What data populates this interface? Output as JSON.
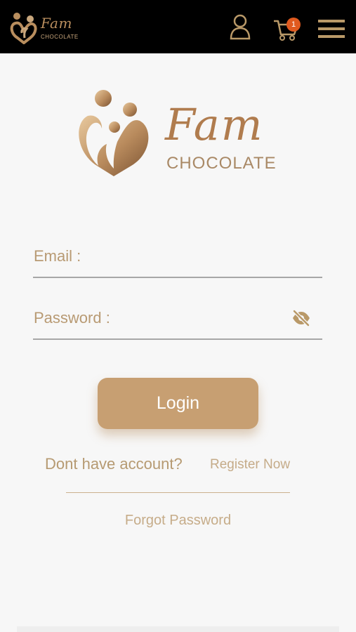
{
  "header": {
    "logo": {
      "brand": "Fam",
      "subtitle": "CHOCOLATE"
    },
    "icons": {
      "user": "user-icon",
      "cart": "cart-icon",
      "menu": "menu-icon"
    },
    "cart_count": "1"
  },
  "main_logo": {
    "brand": "Fam",
    "subtitle": "CHOCOLATE"
  },
  "form": {
    "email": {
      "label": "Email :",
      "value": "",
      "placeholder": ""
    },
    "password": {
      "label": "Password :",
      "value": "",
      "placeholder": "",
      "toggle_icon": "eye-slash-icon"
    },
    "login_label": "Login"
  },
  "register": {
    "prompt": "Dont have account?",
    "link": "Register Now"
  },
  "forgot": {
    "link": "Forgot Password"
  },
  "colors": {
    "primary": "#c79f72",
    "text": "#b69a72",
    "badge": "#e05a1f",
    "header_bg": "#000000"
  }
}
